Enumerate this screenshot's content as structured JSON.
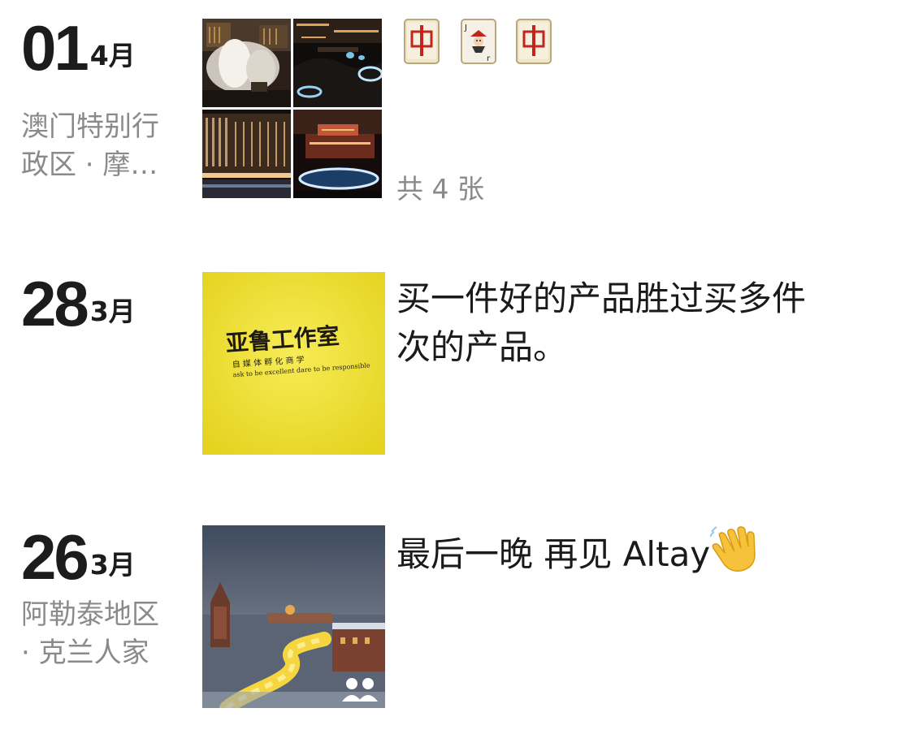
{
  "posts": [
    {
      "day": "01",
      "month": "4月",
      "location_line1": "澳门特别行",
      "location_line2": "政区 · 摩…",
      "caption_icons": [
        "mahjong-red-dragon-icon",
        "joker-card-icon",
        "mahjong-red-dragon-icon"
      ],
      "photo_count": "共 4 张"
    },
    {
      "day": "28",
      "month": "3月",
      "caption_line1": "买一件好的产品胜过买多件",
      "caption_line2": "次的产品。",
      "photo_text_main": "亚鲁工作室",
      "photo_text_sub1": "自 媒 体 孵 化 商 学",
      "photo_text_sub2": "ask to be excellent dare to be responsible"
    },
    {
      "day": "26",
      "month": "3月",
      "location_line1": "阿勒泰地区",
      "location_line2": "· 克兰人家",
      "caption": "最后一晚 再见 Altay",
      "caption_emoji": "waving-hand-icon"
    }
  ],
  "colors": {
    "date_text": "#1c1c1c",
    "secondary_text": "#8a8a8a",
    "caption_text": "#1a1a1a",
    "yellow_photo": "#f2e234"
  }
}
